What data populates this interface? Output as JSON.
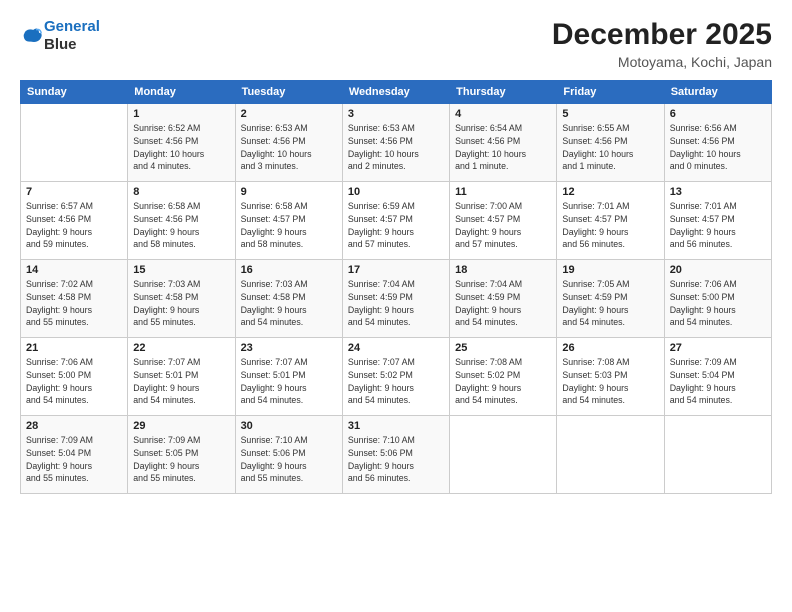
{
  "logo": {
    "line1": "General",
    "line2": "Blue"
  },
  "title": "December 2025",
  "location": "Motoyama, Kochi, Japan",
  "header": {
    "days": [
      "Sunday",
      "Monday",
      "Tuesday",
      "Wednesday",
      "Thursday",
      "Friday",
      "Saturday"
    ]
  },
  "weeks": [
    [
      {
        "num": "",
        "info": ""
      },
      {
        "num": "1",
        "info": "Sunrise: 6:52 AM\nSunset: 4:56 PM\nDaylight: 10 hours\nand 4 minutes."
      },
      {
        "num": "2",
        "info": "Sunrise: 6:53 AM\nSunset: 4:56 PM\nDaylight: 10 hours\nand 3 minutes."
      },
      {
        "num": "3",
        "info": "Sunrise: 6:53 AM\nSunset: 4:56 PM\nDaylight: 10 hours\nand 2 minutes."
      },
      {
        "num": "4",
        "info": "Sunrise: 6:54 AM\nSunset: 4:56 PM\nDaylight: 10 hours\nand 1 minute."
      },
      {
        "num": "5",
        "info": "Sunrise: 6:55 AM\nSunset: 4:56 PM\nDaylight: 10 hours\nand 1 minute."
      },
      {
        "num": "6",
        "info": "Sunrise: 6:56 AM\nSunset: 4:56 PM\nDaylight: 10 hours\nand 0 minutes."
      }
    ],
    [
      {
        "num": "7",
        "info": "Sunrise: 6:57 AM\nSunset: 4:56 PM\nDaylight: 9 hours\nand 59 minutes."
      },
      {
        "num": "8",
        "info": "Sunrise: 6:58 AM\nSunset: 4:56 PM\nDaylight: 9 hours\nand 58 minutes."
      },
      {
        "num": "9",
        "info": "Sunrise: 6:58 AM\nSunset: 4:57 PM\nDaylight: 9 hours\nand 58 minutes."
      },
      {
        "num": "10",
        "info": "Sunrise: 6:59 AM\nSunset: 4:57 PM\nDaylight: 9 hours\nand 57 minutes."
      },
      {
        "num": "11",
        "info": "Sunrise: 7:00 AM\nSunset: 4:57 PM\nDaylight: 9 hours\nand 57 minutes."
      },
      {
        "num": "12",
        "info": "Sunrise: 7:01 AM\nSunset: 4:57 PM\nDaylight: 9 hours\nand 56 minutes."
      },
      {
        "num": "13",
        "info": "Sunrise: 7:01 AM\nSunset: 4:57 PM\nDaylight: 9 hours\nand 56 minutes."
      }
    ],
    [
      {
        "num": "14",
        "info": "Sunrise: 7:02 AM\nSunset: 4:58 PM\nDaylight: 9 hours\nand 55 minutes."
      },
      {
        "num": "15",
        "info": "Sunrise: 7:03 AM\nSunset: 4:58 PM\nDaylight: 9 hours\nand 55 minutes."
      },
      {
        "num": "16",
        "info": "Sunrise: 7:03 AM\nSunset: 4:58 PM\nDaylight: 9 hours\nand 54 minutes."
      },
      {
        "num": "17",
        "info": "Sunrise: 7:04 AM\nSunset: 4:59 PM\nDaylight: 9 hours\nand 54 minutes."
      },
      {
        "num": "18",
        "info": "Sunrise: 7:04 AM\nSunset: 4:59 PM\nDaylight: 9 hours\nand 54 minutes."
      },
      {
        "num": "19",
        "info": "Sunrise: 7:05 AM\nSunset: 4:59 PM\nDaylight: 9 hours\nand 54 minutes."
      },
      {
        "num": "20",
        "info": "Sunrise: 7:06 AM\nSunset: 5:00 PM\nDaylight: 9 hours\nand 54 minutes."
      }
    ],
    [
      {
        "num": "21",
        "info": "Sunrise: 7:06 AM\nSunset: 5:00 PM\nDaylight: 9 hours\nand 54 minutes."
      },
      {
        "num": "22",
        "info": "Sunrise: 7:07 AM\nSunset: 5:01 PM\nDaylight: 9 hours\nand 54 minutes."
      },
      {
        "num": "23",
        "info": "Sunrise: 7:07 AM\nSunset: 5:01 PM\nDaylight: 9 hours\nand 54 minutes."
      },
      {
        "num": "24",
        "info": "Sunrise: 7:07 AM\nSunset: 5:02 PM\nDaylight: 9 hours\nand 54 minutes."
      },
      {
        "num": "25",
        "info": "Sunrise: 7:08 AM\nSunset: 5:02 PM\nDaylight: 9 hours\nand 54 minutes."
      },
      {
        "num": "26",
        "info": "Sunrise: 7:08 AM\nSunset: 5:03 PM\nDaylight: 9 hours\nand 54 minutes."
      },
      {
        "num": "27",
        "info": "Sunrise: 7:09 AM\nSunset: 5:04 PM\nDaylight: 9 hours\nand 54 minutes."
      }
    ],
    [
      {
        "num": "28",
        "info": "Sunrise: 7:09 AM\nSunset: 5:04 PM\nDaylight: 9 hours\nand 55 minutes."
      },
      {
        "num": "29",
        "info": "Sunrise: 7:09 AM\nSunset: 5:05 PM\nDaylight: 9 hours\nand 55 minutes."
      },
      {
        "num": "30",
        "info": "Sunrise: 7:10 AM\nSunset: 5:06 PM\nDaylight: 9 hours\nand 55 minutes."
      },
      {
        "num": "31",
        "info": "Sunrise: 7:10 AM\nSunset: 5:06 PM\nDaylight: 9 hours\nand 56 minutes."
      },
      {
        "num": "",
        "info": ""
      },
      {
        "num": "",
        "info": ""
      },
      {
        "num": "",
        "info": ""
      }
    ]
  ]
}
